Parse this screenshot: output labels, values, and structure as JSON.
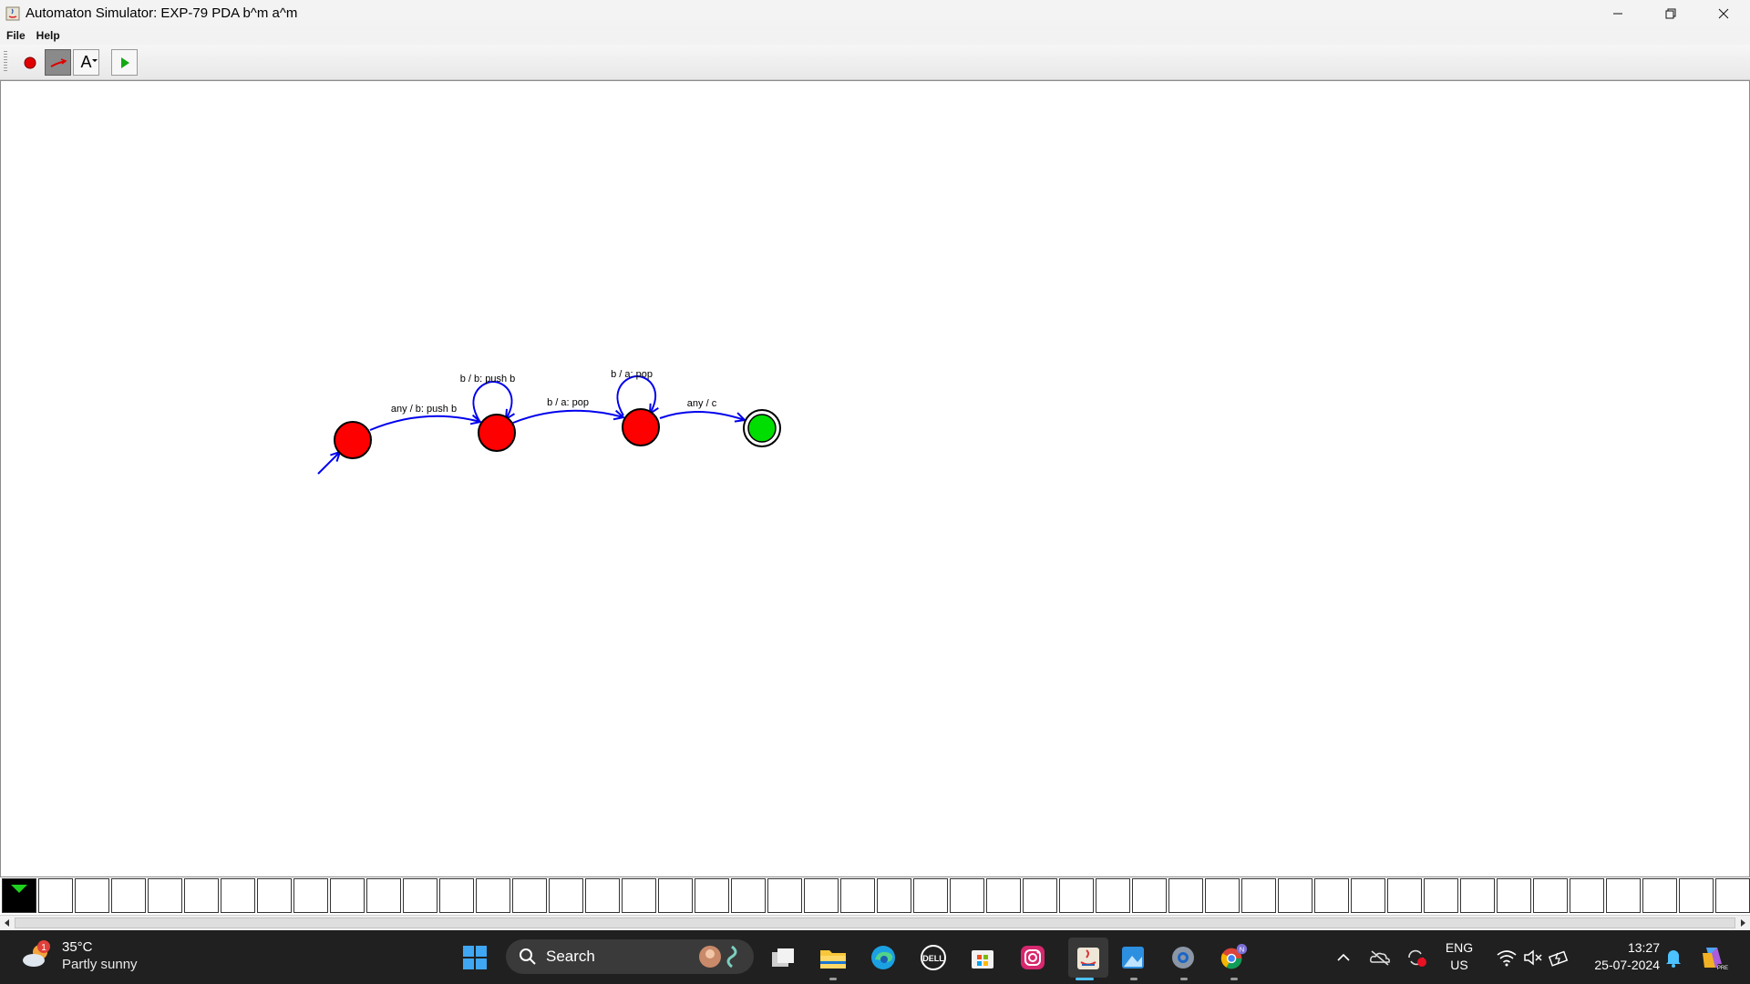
{
  "window": {
    "title": "Automaton Simulator: EXP-79 PDA b^m a^m",
    "controls": [
      "minimize-icon",
      "restore-icon",
      "close-icon"
    ]
  },
  "menu": {
    "items": [
      "File",
      "Help"
    ]
  },
  "toolbar": {
    "tools": [
      {
        "name": "add-state-tool",
        "icon": "red-dot-icon"
      },
      {
        "name": "add-transition-tool",
        "icon": "red-arrow-icon",
        "pressed": true
      },
      {
        "name": "text-tool",
        "label": "A"
      },
      {
        "name": "run-tool",
        "icon": "green-play-icon"
      }
    ]
  },
  "automaton": {
    "states": [
      {
        "id": "q0",
        "kind": "start",
        "color": "#ff0000"
      },
      {
        "id": "q1",
        "kind": "normal",
        "color": "#ff0000"
      },
      {
        "id": "q2",
        "kind": "normal",
        "color": "#ff0000"
      },
      {
        "id": "q3",
        "kind": "accepting",
        "color": "#00dd00"
      }
    ],
    "transitions": [
      {
        "from": "q0",
        "to": "q1",
        "label": "any / b: push b"
      },
      {
        "from": "q1",
        "to": "q1",
        "label": "b / b: push b"
      },
      {
        "from": "q1",
        "to": "q2",
        "label": "b / a: pop"
      },
      {
        "from": "q2",
        "to": "q2",
        "label": "b / a: pop"
      },
      {
        "from": "q2",
        "to": "q3",
        "label": "any / c"
      }
    ],
    "edge_color": "#0000ee"
  },
  "tape": {
    "head_index": 0,
    "head_color": "#1fd11f"
  },
  "taskbar": {
    "weather": {
      "temp": "35°C",
      "desc": "Partly sunny",
      "badge": "1"
    },
    "search_placeholder": "Search",
    "apps": [
      "start-icon",
      "search-icon",
      "task-view-icon",
      "file-explorer-icon",
      "edge-icon",
      "dell-icon",
      "store-icon",
      "instagram-icon",
      "java-icon",
      "photos-icon",
      "settings-icon",
      "chrome-icon"
    ],
    "chrome_badge": "N",
    "tray": {
      "lang_top": "ENG",
      "lang_bottom": "US",
      "time": "13:27",
      "date": "25-07-2024"
    }
  }
}
